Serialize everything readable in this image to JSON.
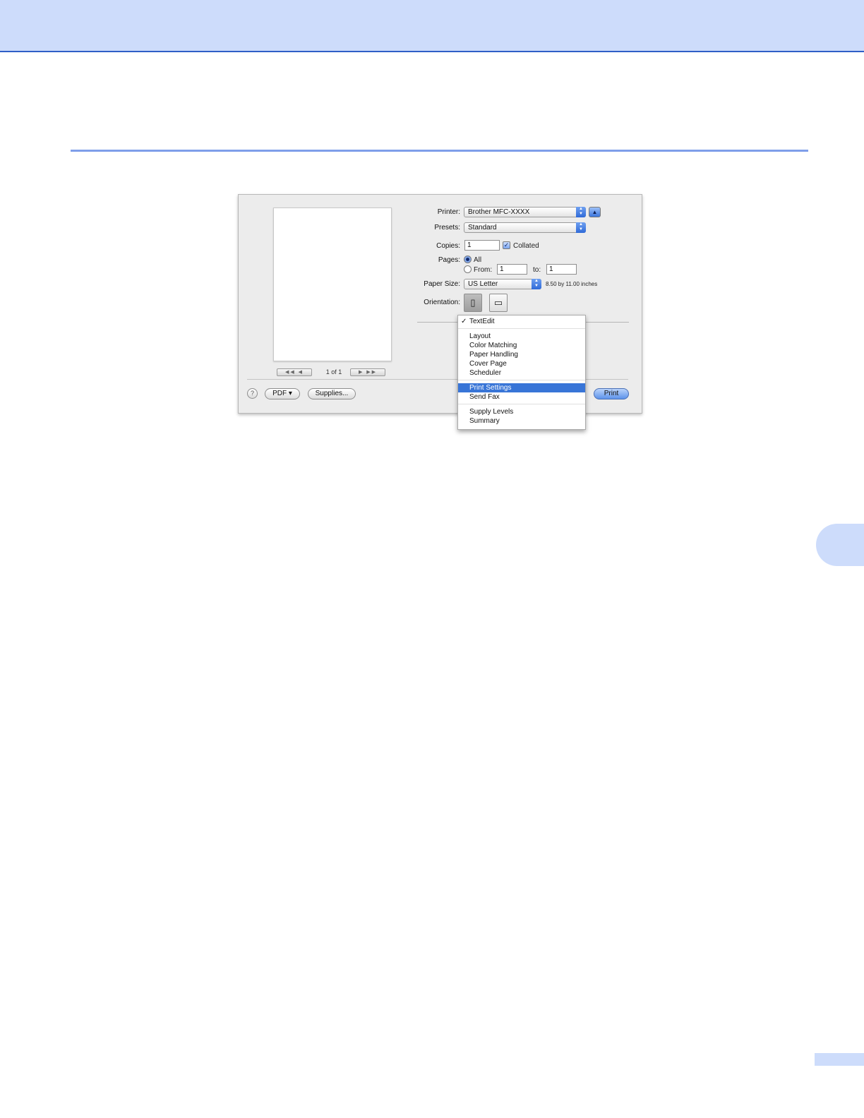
{
  "dialog": {
    "printer_label": "Printer:",
    "printer_value": "Brother MFC-XXXX",
    "presets_label": "Presets:",
    "presets_value": "Standard",
    "copies_label": "Copies:",
    "copies_value": "1",
    "collated_label": "Collated",
    "collated_checked": true,
    "pages_label": "Pages:",
    "pages_all_label": "All",
    "pages_from_label": "From:",
    "pages_from_value": "1",
    "pages_to_label": "to:",
    "pages_to_value": "1",
    "paper_size_label": "Paper Size:",
    "paper_size_value": "US Letter",
    "paper_size_dimensions": "8.50 by 11.00 inches",
    "orientation_label": "Orientation:",
    "page_count": "1 of 1",
    "nav_first_prev": "◀◀ ◀",
    "nav_next_last": "▶ ▶▶",
    "help_label": "?",
    "pdf_label": "PDF ▾",
    "supplies_label": "Supplies...",
    "print_label": "Print"
  },
  "menu": {
    "items": [
      {
        "label": "TextEdit",
        "checked": true
      },
      {
        "label": "Layout"
      },
      {
        "label": "Color Matching"
      },
      {
        "label": "Paper Handling"
      },
      {
        "label": "Cover Page"
      },
      {
        "label": "Scheduler"
      },
      {
        "label": "Print Settings",
        "highlighted": true
      },
      {
        "label": "Send Fax"
      },
      {
        "label": "Supply Levels"
      },
      {
        "label": "Summary"
      }
    ],
    "check_mark": "✓"
  },
  "colors": {
    "header_band": "#cddcfb",
    "header_rule": "#2f5fc7",
    "section_rule": "#7f9eea",
    "menu_highlight": "#3875d7"
  }
}
